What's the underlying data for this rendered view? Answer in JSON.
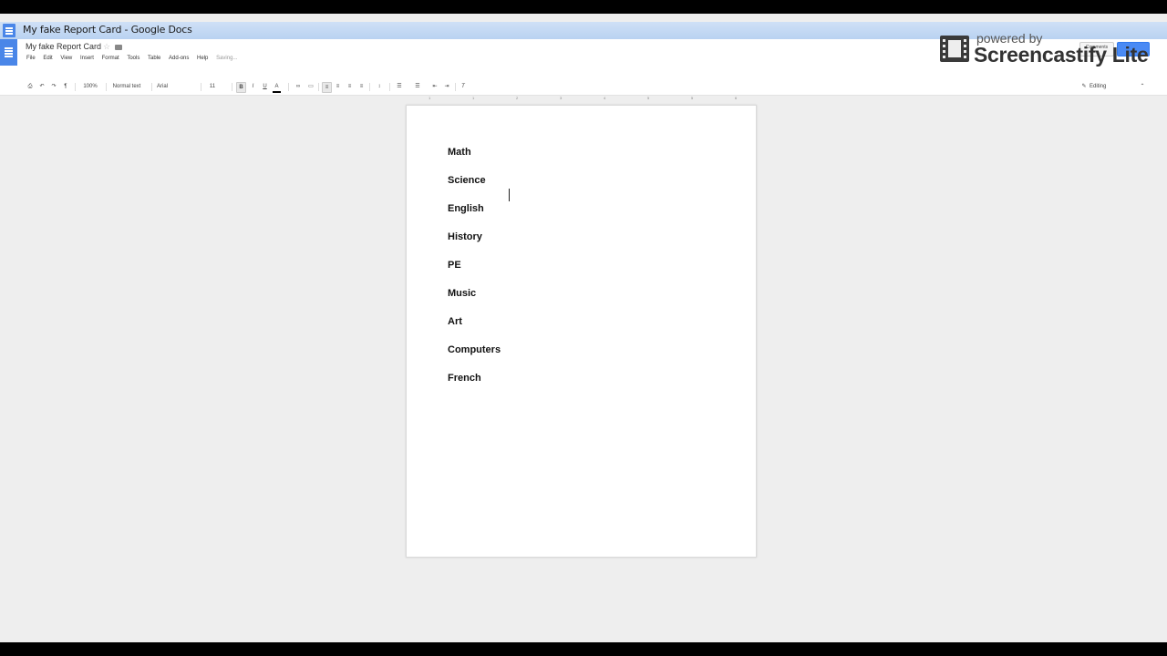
{
  "window": {
    "title": "My fake Report Card - Google Docs"
  },
  "header": {
    "doc_name": "My fake Report Card",
    "star_glyph": "☆",
    "menu": [
      "File",
      "Edit",
      "View",
      "Insert",
      "Format",
      "Tools",
      "Table",
      "Add-ons",
      "Help"
    ],
    "status": "Saving...",
    "comments_label": "Comments"
  },
  "toolbar": {
    "zoom": "100%",
    "style": "Normal text",
    "font": "Arial",
    "font_size": "11",
    "bold": "B",
    "italic": "I",
    "underline": "U",
    "text_color": "A",
    "mode": "Editing",
    "collapse_glyph": "⌃"
  },
  "ruler": {
    "ticks": [
      "1",
      "2",
      "3",
      "4",
      "5",
      "6"
    ]
  },
  "document": {
    "subjects": [
      "Math",
      "Science",
      "English",
      "History",
      "PE",
      "Music",
      "Art",
      "Computers",
      "French"
    ]
  },
  "watermark": {
    "powered_by": "powered by",
    "brand": "Screencastify Lite"
  },
  "colors": {
    "accent": "#4a86e8",
    "titlebar": "#c4d9f3",
    "canvas": "#eeeeee"
  }
}
